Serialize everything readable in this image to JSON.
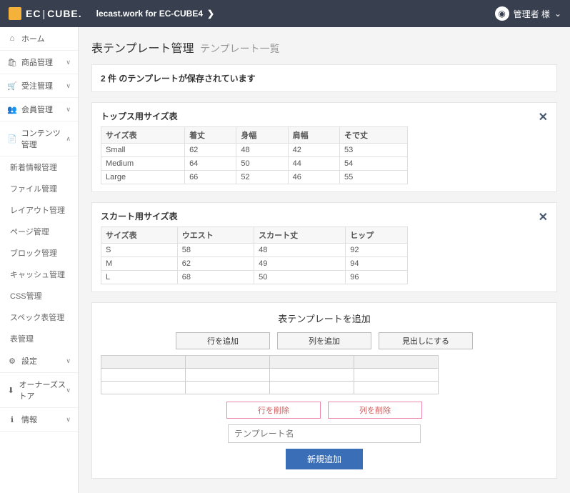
{
  "header": {
    "logo_text_1": "EC",
    "logo_text_2": "CUBE",
    "plugin": "lecast.work for EC-CUBE4",
    "user_name": "管理者 様"
  },
  "sidebar": {
    "items": [
      {
        "icon": "⌂",
        "label": "ホーム"
      },
      {
        "icon": "🛍",
        "label": "商品管理",
        "chev": "∨"
      },
      {
        "icon": "🛒",
        "label": "受注管理",
        "chev": "∨"
      },
      {
        "icon": "👥",
        "label": "会員管理",
        "chev": "∨"
      },
      {
        "icon": "📄",
        "label": "コンテンツ管理",
        "chev": "∧"
      }
    ],
    "sub": [
      "新着情報管理",
      "ファイル管理",
      "レイアウト管理",
      "ページ管理",
      "ブロック管理",
      "キャッシュ管理",
      "CSS管理",
      "スペック表管理",
      "表管理"
    ],
    "items2": [
      {
        "icon": "⚙",
        "label": "設定",
        "chev": "∨"
      },
      {
        "icon": "⬇",
        "label": "オーナーズストア",
        "chev": "∨"
      },
      {
        "icon": "ℹ",
        "label": "情報",
        "chev": "∨"
      }
    ]
  },
  "page": {
    "title": "表テンプレート管理",
    "subtitle": "テンプレート一覧",
    "count_prefix": "2 件",
    "count_suffix": " のテンプレートが保存されています"
  },
  "templates": [
    {
      "name": "トップス用サイズ表",
      "headers": [
        "サイズ表",
        "着丈",
        "身幅",
        "肩幅",
        "そで丈"
      ],
      "rows": [
        [
          "Small",
          "62",
          "48",
          "42",
          "53"
        ],
        [
          "Medium",
          "64",
          "50",
          "44",
          "54"
        ],
        [
          "Large",
          "66",
          "52",
          "46",
          "55"
        ]
      ]
    },
    {
      "name": "スカート用サイズ表",
      "headers": [
        "サイズ表",
        "ウエスト",
        "スカート丈",
        "ヒップ"
      ],
      "rows": [
        [
          "S",
          "58",
          "48",
          "92"
        ],
        [
          "M",
          "62",
          "49",
          "94"
        ],
        [
          "L",
          "68",
          "50",
          "96"
        ]
      ]
    }
  ],
  "add": {
    "title": "表テンプレートを追加",
    "btn_add_row": "行を追加",
    "btn_add_col": "列を追加",
    "btn_heading": "見出しにする",
    "btn_del_row": "行を削除",
    "btn_del_col": "列を削除",
    "name_placeholder": "テンプレート名",
    "submit": "新規追加"
  }
}
